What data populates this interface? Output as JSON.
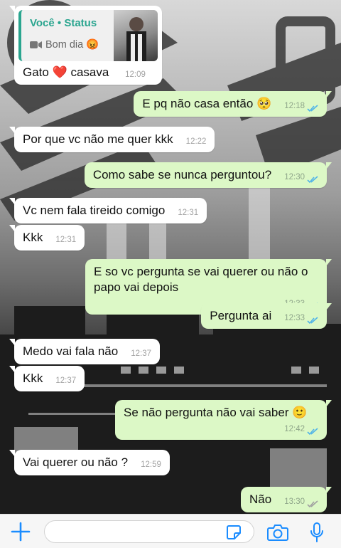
{
  "status_reply": {
    "author": "Você • Status",
    "preview_text": "Bom dia 😡",
    "message": "Gato ❤️ casava",
    "time": "12:09"
  },
  "messages": [
    {
      "dir": "out",
      "text": "E pq não casa então 🥺",
      "time": "12:18"
    },
    {
      "dir": "in",
      "text": "Por que vc não me quer kkk",
      "time": "12:22"
    },
    {
      "dir": "out",
      "text": "Como sabe se nunca perguntou?",
      "time": "12:30"
    },
    {
      "dir": "in",
      "text": "Vc nem fala tireido comigo",
      "time": "12:31"
    },
    {
      "dir": "in",
      "text": "Kkk",
      "time": "12:31"
    },
    {
      "dir": "out",
      "text": "E so vc pergunta se vai querer ou não o papo vai depois",
      "time": "12:33"
    },
    {
      "dir": "out",
      "text": "Pergunta ai",
      "time": "12:33"
    },
    {
      "dir": "in",
      "text": "Medo vai fala não",
      "time": "12:37"
    },
    {
      "dir": "in",
      "text": "Kkk",
      "time": "12:37"
    },
    {
      "dir": "out",
      "text": "Se não pergunta não vai saber 🙂",
      "time": "12:42"
    },
    {
      "dir": "in",
      "text": "Vai querer ou não ?",
      "time": "12:59"
    },
    {
      "dir": "out",
      "text": "Não",
      "time": "13:30"
    }
  ],
  "input_bar": {
    "placeholder": "",
    "icons": [
      "plus-icon",
      "sticker-icon",
      "camera-icon",
      "microphone-icon"
    ]
  },
  "colors": {
    "incoming_bubble": "#ffffff",
    "outgoing_bubble": "#dcf8c6",
    "read_ticks": "#4fb3e8",
    "status_accent": "#2aa58f",
    "icon_blue": "#1a8cff"
  }
}
